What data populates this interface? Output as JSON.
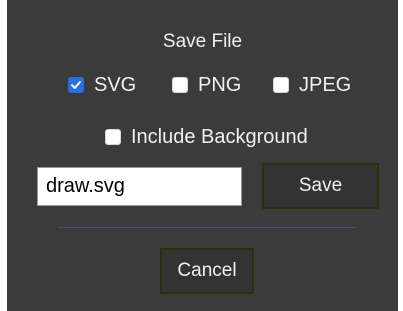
{
  "dialog": {
    "title": "Save File",
    "formats": [
      {
        "label": "SVG",
        "checked": true
      },
      {
        "label": "PNG",
        "checked": false
      },
      {
        "label": "JPEG",
        "checked": false
      }
    ],
    "include_background": {
      "label": "Include Background",
      "checked": false
    },
    "filename": {
      "value": "draw.svg"
    },
    "save_label": "Save",
    "cancel_label": "Cancel"
  },
  "colors": {
    "dialog_bg": "#3b3b3b",
    "checkbox_accent": "#2a6fe0",
    "button_border": "#2c2f0a"
  },
  "icons": {
    "checkmark": "check-icon"
  }
}
